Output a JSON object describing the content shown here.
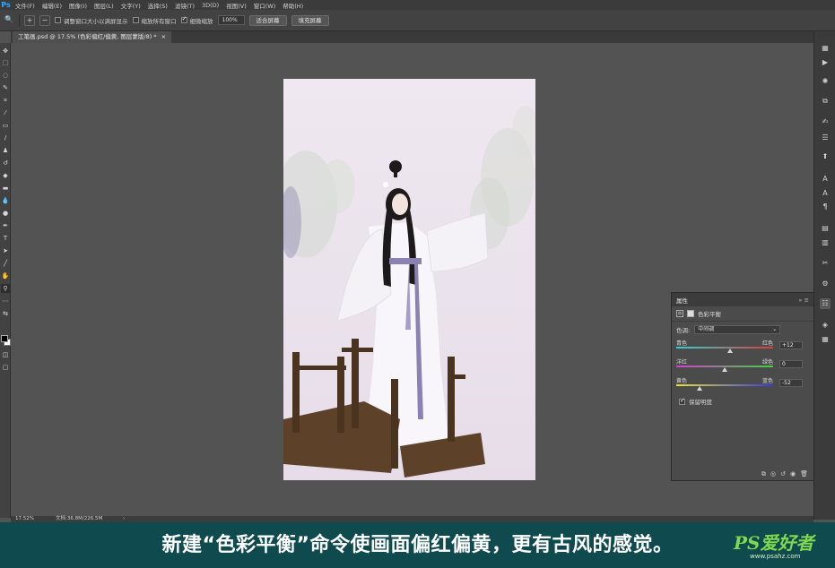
{
  "menubar": {
    "logo": "Ps",
    "items": [
      "文件(F)",
      "编辑(E)",
      "图像(I)",
      "图层(L)",
      "文字(Y)",
      "选择(S)",
      "滤镜(T)",
      "3D(D)",
      "视图(V)",
      "窗口(W)",
      "帮助(H)"
    ]
  },
  "options": {
    "resize_windows": "调整窗口大小以满屏显示",
    "zoom_all": "缩放所有窗口",
    "scrubby_zoom": "细微缩放",
    "zoom_value": "100%",
    "fit_screen": "适合屏幕",
    "fill_screen": "填充屏幕",
    "checks": {
      "resize_windows": false,
      "zoom_all": false,
      "scrubby_zoom": true
    }
  },
  "document_tab": {
    "title": "工笔画.psd @ 17.5% (色彩偏红/偏黄, 图层蒙版/8) *",
    "close": "×"
  },
  "properties": {
    "panel_title": "属性",
    "collapse": "»",
    "menu": "≡",
    "adjustment_name": "色彩平衡",
    "tone_label": "色调:",
    "tone_value": "中间调",
    "sliders": [
      {
        "left": "青色",
        "right": "红色",
        "value": "+12",
        "position": 0.56,
        "colors": [
          "#2fd3d3",
          "#e03a3a"
        ]
      },
      {
        "left": "洋红",
        "right": "绿色",
        "value": "0",
        "position": 0.5,
        "colors": [
          "#d33fd3",
          "#3fd33f"
        ]
      },
      {
        "left": "黄色",
        "right": "蓝色",
        "value": "-52",
        "position": 0.24,
        "colors": [
          "#e3e33a",
          "#3a3ae3"
        ]
      }
    ],
    "preserve_luminosity": "保留明度",
    "preserve_checked": true
  },
  "status": {
    "zoom": "17.52%",
    "doc": "文档:36.8M/226.5M",
    "arrow": "›"
  },
  "caption": "新建“色彩平衡”命令使画面偏红偏黄，更有古风的感觉。",
  "watermark": {
    "main": "PS爱好者",
    "sub": "www.psahz.com"
  }
}
